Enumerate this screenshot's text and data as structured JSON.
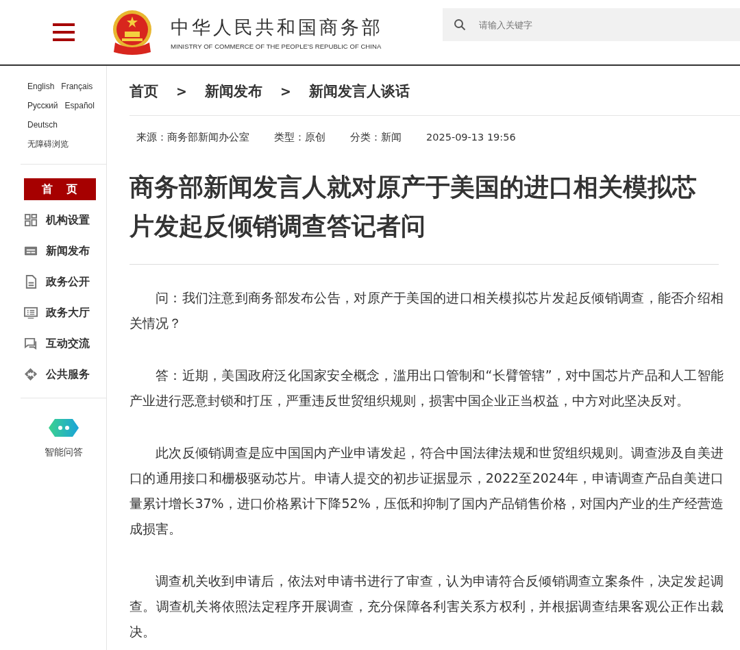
{
  "header": {
    "title": "中华人民共和国商务部",
    "subtitle": "MINISTRY OF COMMERCE OF THE PEOPLE'S REPUBLIC OF CHINA",
    "search": {
      "placeholder": "请输入关键字"
    }
  },
  "sidebar": {
    "languages": [
      [
        "English",
        "Français"
      ],
      [
        "Русский",
        "Español"
      ],
      [
        "Deutsch"
      ],
      [
        "无障碍浏览"
      ]
    ],
    "nav": [
      {
        "label": "首　页",
        "kind": "home",
        "selected": true
      },
      {
        "label": "机构设置",
        "kind": "grid",
        "selected": false
      },
      {
        "label": "新闻发布",
        "kind": "news",
        "selected": false
      },
      {
        "label": "政务公开",
        "kind": "doc",
        "selected": false
      },
      {
        "label": "政务大厅",
        "kind": "monitor",
        "selected": false
      },
      {
        "label": "互动交流",
        "kind": "chat",
        "selected": false
      },
      {
        "label": "公共服务",
        "kind": "service",
        "selected": false
      }
    ],
    "assistant": "智能问答"
  },
  "breadcrumb": [
    "首页",
    "新闻发布",
    "新闻发言人谈话"
  ],
  "breadcrumb_separators": [
    ">",
    ">"
  ],
  "meta": [
    "来源：商务部新闻办公室",
    "类型：原创",
    "分类：新闻",
    "2025-09-13 19:56"
  ],
  "article": {
    "title": "商务部新闻发言人就对原产于美国的进口相关模拟芯片发起反倾销调查答记者问",
    "paragraphs": [
      "问：我们注意到商务部发布公告，对原产于美国的进口相关模拟芯片发起反倾销调查，能否介绍相关情况？",
      "答：近期，美国政府泛化国家安全概念，滥用出口管制和“长臂管辖”，对中国芯片产品和人工智能产业进行恶意封锁和打压，严重违反世贸组织规则，损害中国企业正当权益，中方对此坚决反对。",
      "此次反倾销调查是应中国国内产业申请发起，符合中国法律法规和世贸组织规则。调查涉及自美进口的通用接口和栅极驱动芯片。申请人提交的初步证据显示，2022至2024年，申请调查产品自美进口量累计增长37%，进口价格累计下降52%，压低和抑制了国内产品销售价格，对国内产业的生产经营造成损害。",
      "调查机关收到申请后，依法对申请书进行了审查，认为申请符合反倾销调查立案条件，决定发起调查。调查机关将依照法定程序开展调查，充分保障各利害关系方权利，并根据调查结果客观公正作出裁决。"
    ]
  }
}
